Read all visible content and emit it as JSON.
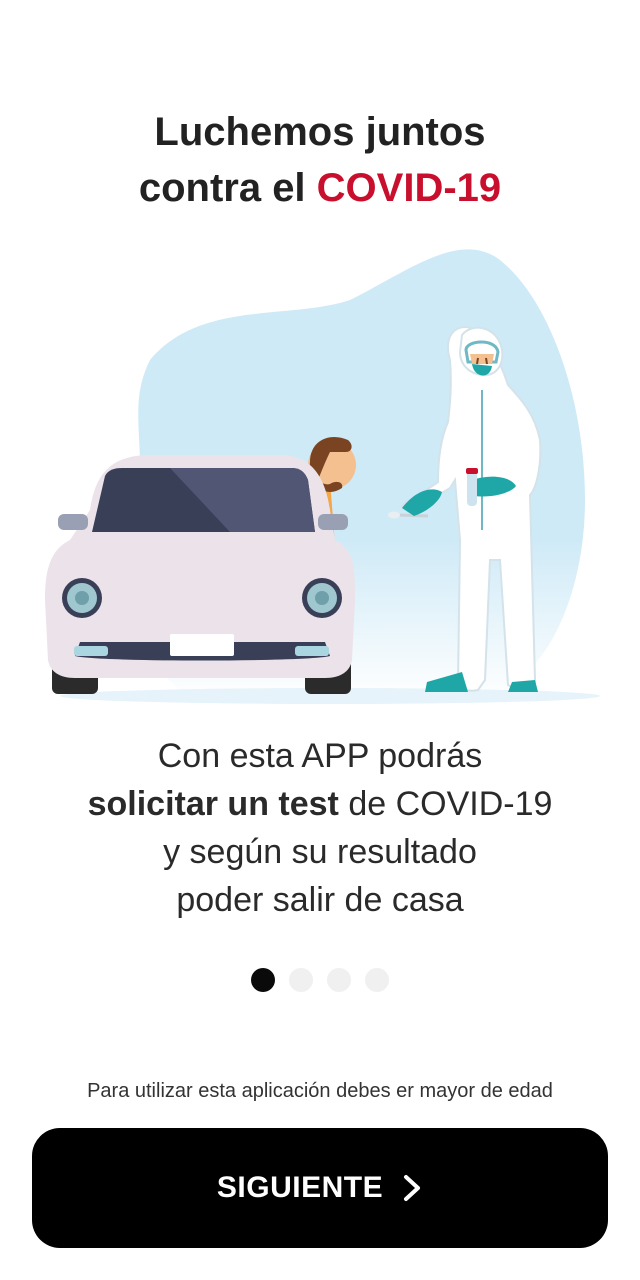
{
  "header": {
    "title_line1": "Luchemos juntos",
    "title_line2_prefix": "contra el ",
    "title_line2_accent": "COVID-19"
  },
  "colors": {
    "accent": "#c8102e",
    "button_bg": "#000000",
    "button_text": "#ffffff",
    "dot_active": "#0a0a0a",
    "dot_inactive": "#f0f0f0",
    "illustration_blob": "#cfeaf7",
    "car_body": "#ebe3e9",
    "glove_teal": "#1fa7a7"
  },
  "illustration": {
    "icons": [
      "car-icon",
      "driver-icon",
      "health-worker-icon",
      "test-tube-icon",
      "swab-icon"
    ]
  },
  "body": {
    "line1": "Con esta APP podrás",
    "line2_bold": "solicitar un test",
    "line2_rest": " de COVID-19",
    "line3": "y según su resultado",
    "line4": "poder salir de casa"
  },
  "pagination": {
    "total": 4,
    "current": 1
  },
  "footer": {
    "legal_text": "Para utilizar esta aplicación debes er mayor de edad",
    "next_label": "SIGUIENTE",
    "next_icon": "chevron-right-icon"
  }
}
